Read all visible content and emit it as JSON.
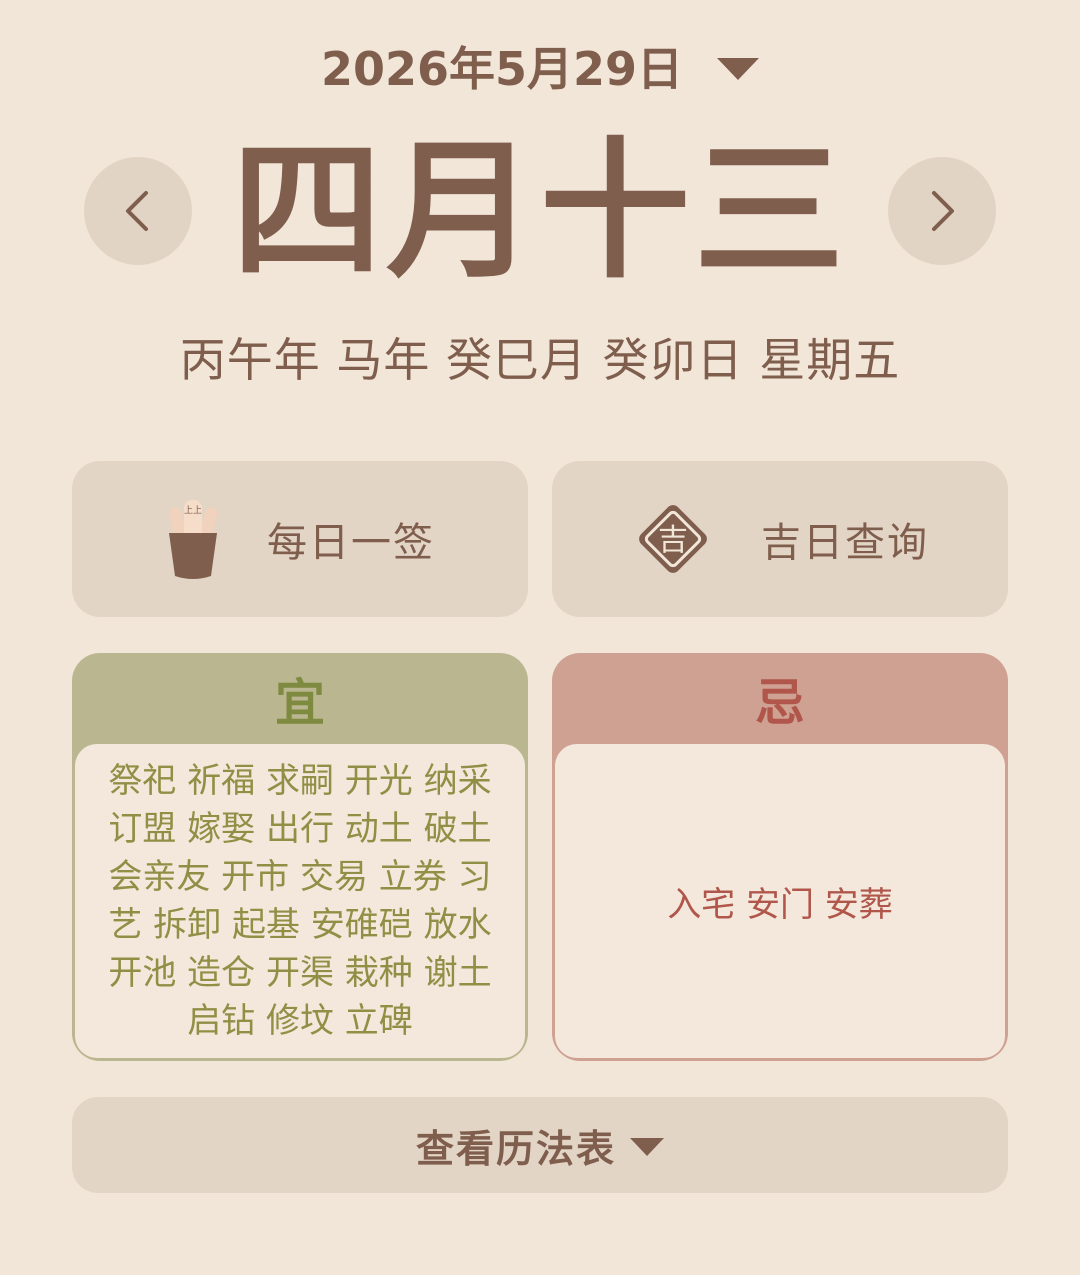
{
  "header": {
    "date": "2026年5月29日",
    "lunar_date": "四月十三",
    "ganzhi": "丙午年 马年 癸巳月 癸卯日 星期五"
  },
  "actions": {
    "daily_lot": "每日一签",
    "lucky_day": "吉日查询",
    "lot_icon_text": "上上",
    "lucky_icon_text": "吉"
  },
  "suitable": {
    "title": "宜",
    "items": "祭祀 祈福 求嗣 开光 纳采 订盟 嫁娶 出行 动土 破土 会亲友 开市 交易 立券 习艺 拆卸 起基 安碓硙 放水 开池 造仓 开渠 栽种 谢土 启钻 修坟 立碑"
  },
  "avoid": {
    "title": "忌",
    "items": "入宅 安门 安葬"
  },
  "footer": {
    "calendar_label": "查看历法表"
  },
  "colors": {
    "background": "#f2e6d8",
    "primary_text": "#7f5e4d",
    "suitable_accent": "#b9b690",
    "avoid_accent": "#cfa192"
  }
}
